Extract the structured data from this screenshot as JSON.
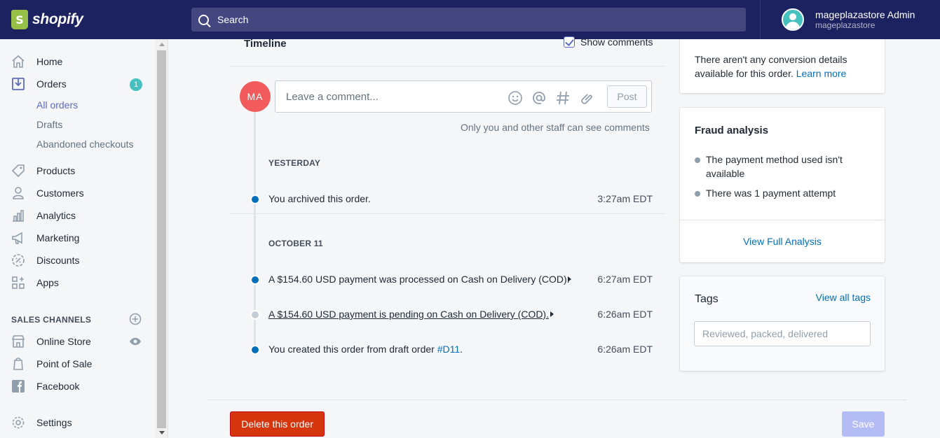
{
  "brand": {
    "name": "shopify"
  },
  "search": {
    "placeholder": "Search"
  },
  "user": {
    "name": "mageplazastore Admin",
    "store": "mageplazastore"
  },
  "sidebar": {
    "items": [
      {
        "label": "Home",
        "icon": "home-icon"
      },
      {
        "label": "Orders",
        "icon": "orders-icon",
        "badge": "1"
      },
      {
        "label": "Products",
        "icon": "tag-icon"
      },
      {
        "label": "Customers",
        "icon": "person-icon"
      },
      {
        "label": "Analytics",
        "icon": "bar-chart-icon"
      },
      {
        "label": "Marketing",
        "icon": "megaphone-icon"
      },
      {
        "label": "Discounts",
        "icon": "discount-icon"
      },
      {
        "label": "Apps",
        "icon": "apps-icon"
      }
    ],
    "orders_sub": [
      "All orders",
      "Drafts",
      "Abandoned checkouts"
    ],
    "sales_channels_title": "SALES CHANNELS",
    "channels": [
      {
        "label": "Online Store",
        "icon": "store-icon"
      },
      {
        "label": "Point of Sale",
        "icon": "pos-icon"
      },
      {
        "label": "Facebook",
        "icon": "facebook-icon"
      }
    ],
    "settings": "Settings"
  },
  "timeline": {
    "title": "Timeline",
    "show_comments": "Show comments",
    "avatar_initials": "MA",
    "comment_placeholder": "Leave a comment...",
    "post_label": "Post",
    "staff_note": "Only you and other staff can see comments",
    "groups": [
      {
        "date": "YESTERDAY",
        "events": [
          {
            "text": "You archived this order.",
            "time": "3:27am EDT"
          }
        ]
      },
      {
        "date": "OCTOBER 11",
        "events": [
          {
            "text": "A $154.60 USD payment was processed on Cash on Delivery (COD).",
            "time": "6:27am EDT"
          },
          {
            "text": "A $154.60 USD payment is pending on Cash on Delivery (COD).",
            "time": "6:26am EDT"
          },
          {
            "text": "You created this order from draft order ",
            "link": "#D11",
            "suffix": ".",
            "time": "6:26am EDT"
          }
        ]
      }
    ]
  },
  "conversion": {
    "text": "There aren't any conversion details available for this order. ",
    "link": "Learn more"
  },
  "fraud": {
    "title": "Fraud analysis",
    "items": [
      "The payment method used isn't available",
      "There was 1 payment attempt"
    ],
    "link": "View Full Analysis"
  },
  "tags": {
    "title": "Tags",
    "view_all": "View all tags",
    "placeholder": "Reviewed, packed, delivered"
  },
  "actions": {
    "delete": "Delete this order",
    "save": "Save"
  },
  "colors": {
    "topbar": "#1c2260",
    "accent": "#5c6ac4",
    "danger": "#d6360e",
    "link": "#006fbb",
    "badge": "#47c1bf"
  }
}
